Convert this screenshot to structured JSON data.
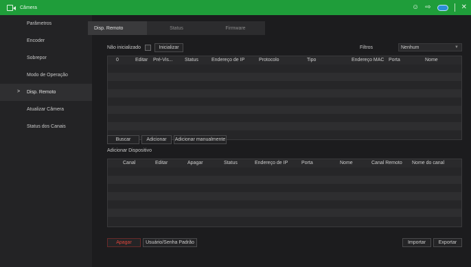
{
  "topbar": {
    "title": "Câmera"
  },
  "sidebar": {
    "items": [
      {
        "label": "Parâmetros"
      },
      {
        "label": "Encoder"
      },
      {
        "label": "Sobrepor"
      },
      {
        "label": "Modo de Operação"
      },
      {
        "label": "Disp. Remoto"
      },
      {
        "label": "Atualizar Câmera"
      },
      {
        "label": "Status dos Canais"
      }
    ]
  },
  "tabs": [
    {
      "label": "Disp. Remoto"
    },
    {
      "label": "Status"
    },
    {
      "label": "Firmware"
    }
  ],
  "filter_row": {
    "uninitialized_label": "Não inicializado",
    "initialize_label": "Inicializar",
    "filters_label": "Filtros",
    "filter_value": "Nenhum"
  },
  "device_table": {
    "columns": [
      "0",
      "Editar",
      "Pré-Vis...",
      "Status",
      "Endereço de IP",
      "Protocolo",
      "Tipo",
      "Endereço MAC",
      "Porta",
      "Nome"
    ]
  },
  "actions": {
    "search": "Buscar",
    "add": "Adicionar",
    "add_manual": "Adicionar manualmente"
  },
  "added_section": {
    "title": "Adicionar Dispositivo"
  },
  "added_table": {
    "columns": [
      "Canal",
      "Editar",
      "Apagar",
      "Status",
      "Endereço de IP",
      "Porta",
      "Nome",
      "Canal Remoto",
      "Nome do canal"
    ]
  },
  "footer": {
    "delete": "Apagar",
    "default_credentials": "Usuário/Senha Padrão",
    "import": "Importar",
    "export": "Exportar"
  }
}
